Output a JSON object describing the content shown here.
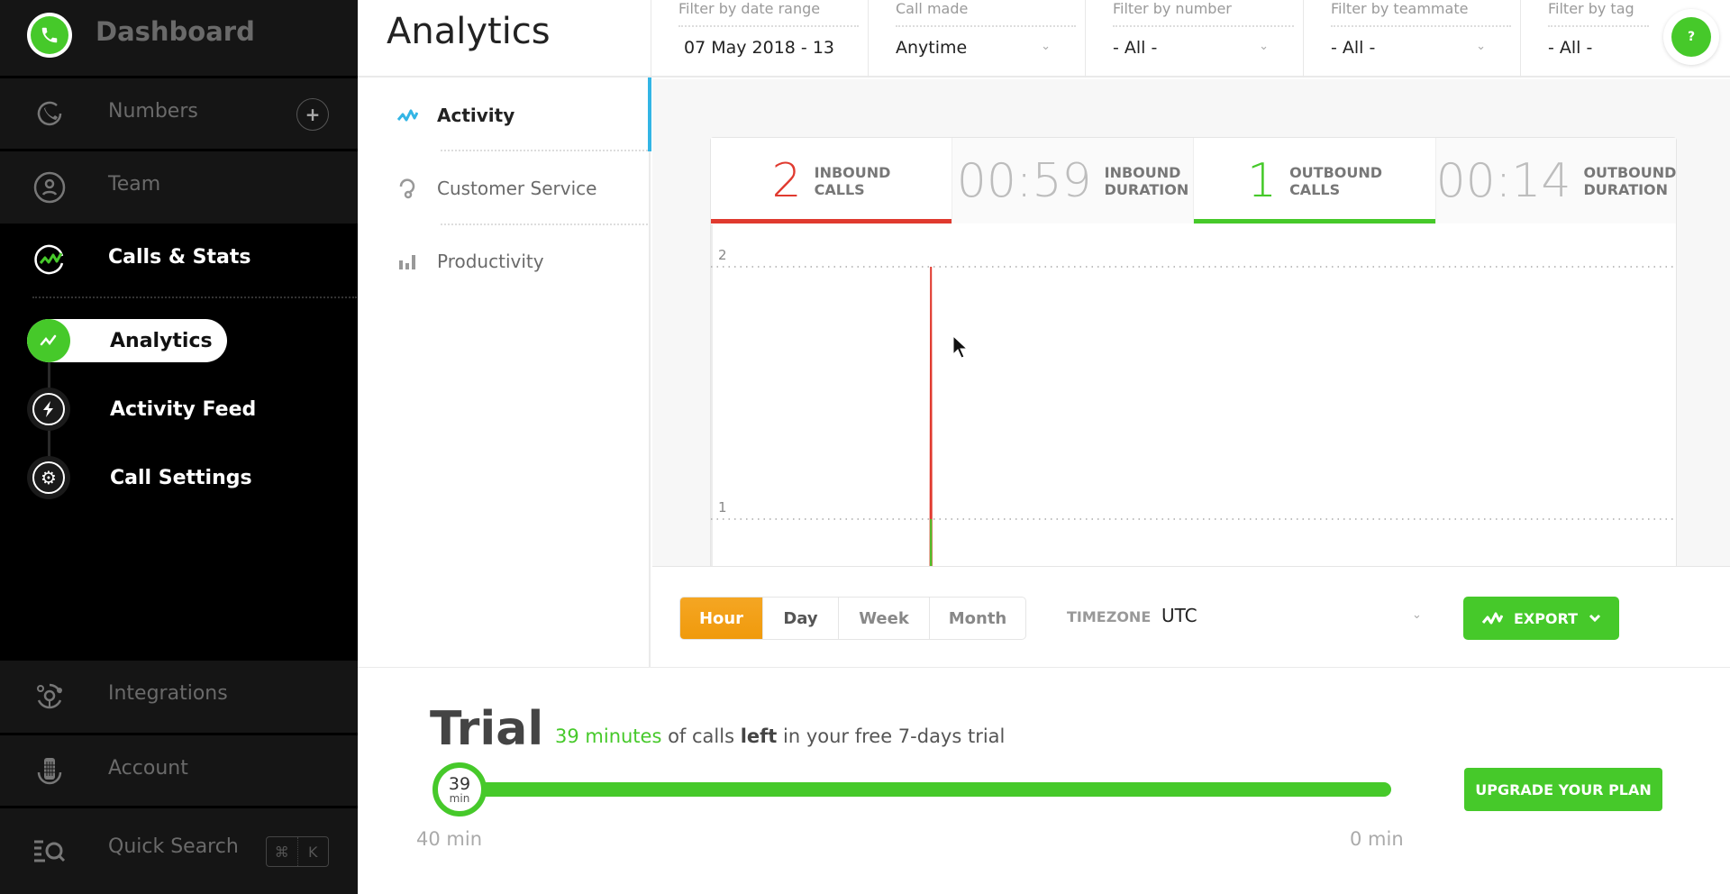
{
  "sidebar": {
    "title": "Dashboard",
    "items": [
      {
        "label": "Numbers",
        "icon": "phone-ring-icon"
      },
      {
        "label": "Team",
        "icon": "user-circle-icon"
      },
      {
        "label": "Calls & Stats",
        "icon": "stats-wave-icon"
      }
    ],
    "sub_items": [
      {
        "label": "Analytics",
        "icon": "wave-icon",
        "active": true
      },
      {
        "label": "Activity Feed",
        "icon": "lightning-icon"
      },
      {
        "label": "Call Settings",
        "icon": "gear-icon"
      }
    ],
    "bottom_items": [
      {
        "label": "Integrations",
        "icon": "integrations-icon"
      },
      {
        "label": "Account",
        "icon": "account-icon"
      },
      {
        "label": "Quick Search",
        "icon": "quick-search-icon"
      }
    ],
    "shortcut": {
      "mod": "⌘",
      "key": "K"
    }
  },
  "header": {
    "title": "Analytics",
    "filters": [
      {
        "label": "Filter by date range",
        "value": "07 May 2018 - 13"
      },
      {
        "label": "Call made",
        "value": "Anytime"
      },
      {
        "label": "Filter by number",
        "value": "- All -"
      },
      {
        "label": "Filter by teammate",
        "value": "- All -"
      },
      {
        "label": "Filter by tag",
        "value": "- All -"
      }
    ],
    "help_label": "?"
  },
  "subnav": {
    "items": [
      {
        "label": "Activity",
        "active": true
      },
      {
        "label": "Customer Service"
      },
      {
        "label": "Productivity"
      }
    ]
  },
  "stats": [
    {
      "value": "2",
      "line1": "INBOUND",
      "line2": "CALLS",
      "color": "#e03a2f",
      "selected": true
    },
    {
      "value": "00:59",
      "line1": "INBOUND",
      "line2": "DURATION",
      "color": "#bdbdbd",
      "selected": false
    },
    {
      "value": "1",
      "line1": "OUTBOUND",
      "line2": "CALLS",
      "color": "#46c92a",
      "selected": true
    },
    {
      "value": "00:14",
      "line1": "OUTBOUND",
      "line2": "DURATION",
      "color": "#bdbdbd",
      "selected": false
    }
  ],
  "chart_data": {
    "type": "line",
    "title": "",
    "xlabel": "",
    "ylabel": "",
    "ylim": [
      0,
      2
    ],
    "y_ticks": [
      "1",
      "2"
    ],
    "grid": true,
    "x_range": [
      0,
      1
    ],
    "series": [
      {
        "name": "Inbound calls",
        "color": "#e03a2f",
        "points": [
          [
            0.227,
            0
          ],
          [
            0.228,
            2
          ],
          [
            0.229,
            0
          ]
        ]
      },
      {
        "name": "Outbound calls",
        "color": "#46c92a",
        "points": [
          [
            0.2275,
            0
          ],
          [
            0.228,
            1
          ],
          [
            0.2285,
            0
          ]
        ]
      }
    ]
  },
  "controls": {
    "granularity": [
      {
        "label": "Hour",
        "active": true
      },
      {
        "label": "Day"
      },
      {
        "label": "Week"
      },
      {
        "label": "Month"
      }
    ],
    "timezone_label": "TIMEZONE",
    "timezone_value": "UTC",
    "export_label": "EXPORT"
  },
  "trial": {
    "title": "Trial",
    "minutes_text": "39 minutes",
    "text_mid": " of calls ",
    "text_bold": "left",
    "text_end": " in your free 7-days trial",
    "remaining": "39",
    "remaining_unit": "min",
    "remaining_fraction": 0.975,
    "start_label": "40 min",
    "end_label": "0 min",
    "upgrade_label": "UPGRADE YOUR PLAN"
  },
  "colors": {
    "accent_green": "#46c92a",
    "accent_orange": "#f5a623",
    "inbound_red": "#e03a2f",
    "activity_blue": "#33b5e5"
  }
}
